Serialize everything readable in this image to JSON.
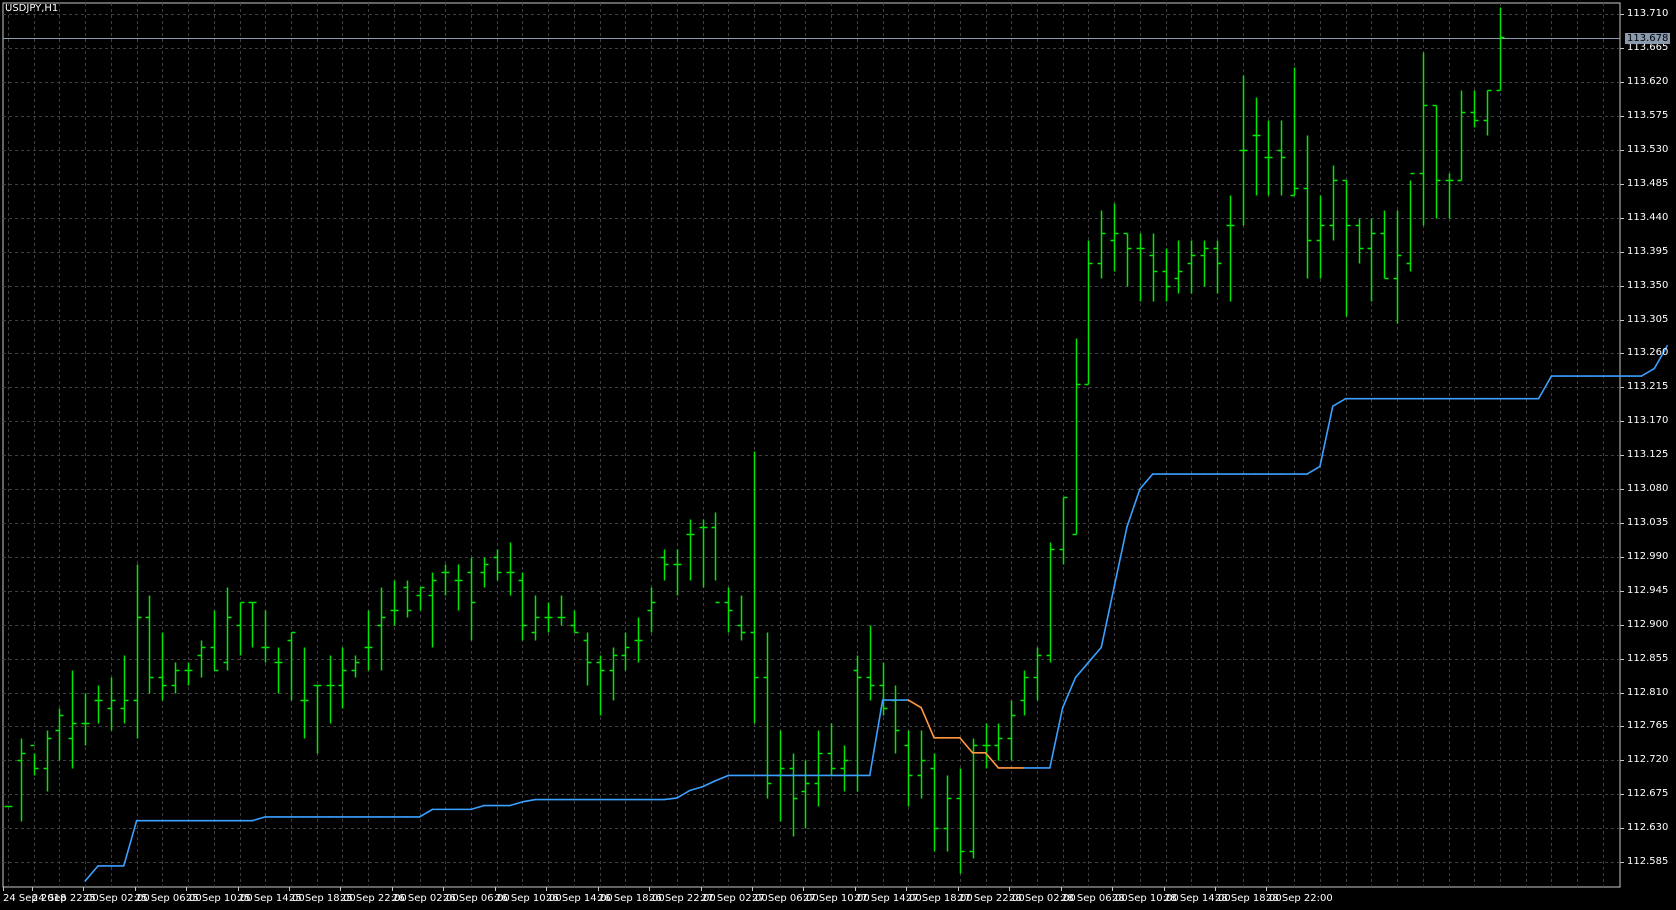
{
  "window_title": "USDJPY,H1",
  "colors": {
    "background": "#000000",
    "grid": "#404040",
    "bars": "#00e600",
    "ma_up": "#3ba0ff",
    "ma_down": "#ff9a40",
    "axis_text": "#ffffff",
    "price_line": "#8a9bb0"
  },
  "chart_data": {
    "type": "line",
    "title": "USDJPY,H1",
    "series_types": [
      "ohlc",
      "line"
    ],
    "ylim": [
      112.552,
      113.725
    ],
    "grid": true,
    "y_ticks": [
      "113.710",
      "113.665",
      "113.620",
      "113.575",
      "113.530",
      "113.485",
      "113.440",
      "113.395",
      "113.350",
      "113.305",
      "113.260",
      "113.215",
      "113.170",
      "113.125",
      "113.080",
      "113.035",
      "112.990",
      "112.945",
      "112.900",
      "112.855",
      "112.810",
      "112.765",
      "112.720",
      "112.675",
      "112.630",
      "112.585"
    ],
    "x_ticks": [
      "24 Sep 2018",
      "24 Sep 22:00",
      "25 Sep 02:00",
      "25 Sep 06:00",
      "25 Sep 10:00",
      "25 Sep 14:00",
      "25 Sep 18:00",
      "25 Sep 22:00",
      "26 Sep 02:00",
      "26 Sep 06:00",
      "26 Sep 10:00",
      "26 Sep 14:00",
      "26 Sep 18:00",
      "26 Sep 22:00",
      "27 Sep 02:00",
      "27 Sep 06:00",
      "27 Sep 10:00",
      "27 Sep 14:00",
      "27 Sep 18:00",
      "27 Sep 22:00",
      "28 Sep 02:00",
      "28 Sep 06:00",
      "28 Sep 10:00",
      "28 Sep 14:00",
      "28 Sep 18:00",
      "28 Sep 22:00"
    ],
    "current_price": "113.678",
    "ohlc": [
      [
        112.66,
        112.66,
        112.66,
        112.66
      ],
      [
        112.72,
        112.75,
        112.64,
        112.73
      ],
      [
        112.74,
        112.73,
        112.7,
        112.71
      ],
      [
        112.71,
        112.76,
        112.68,
        112.75
      ],
      [
        112.76,
        112.79,
        112.72,
        112.78
      ],
      [
        112.75,
        112.84,
        112.71,
        112.77
      ],
      [
        112.77,
        112.81,
        112.74,
        112.77
      ],
      [
        112.8,
        112.82,
        112.77,
        112.8
      ],
      [
        112.79,
        112.83,
        112.76,
        112.8
      ],
      [
        112.79,
        112.86,
        112.77,
        112.8
      ],
      [
        112.8,
        112.98,
        112.75,
        112.91
      ],
      [
        112.91,
        112.94,
        112.81,
        112.83
      ],
      [
        112.83,
        112.89,
        112.8,
        112.82
      ],
      [
        112.82,
        112.85,
        112.81,
        112.84
      ],
      [
        112.84,
        112.85,
        112.82,
        112.84
      ],
      [
        112.86,
        112.88,
        112.83,
        112.87
      ],
      [
        112.87,
        112.92,
        112.84,
        112.84
      ],
      [
        112.85,
        112.95,
        112.84,
        112.91
      ],
      [
        112.9,
        112.93,
        112.86,
        112.93
      ],
      [
        112.93,
        112.93,
        112.87,
        112.93
      ],
      [
        112.87,
        112.92,
        112.85,
        112.87
      ],
      [
        112.85,
        112.87,
        112.81,
        112.85
      ],
      [
        112.88,
        112.89,
        112.8,
        112.89
      ],
      [
        112.8,
        112.87,
        112.75,
        112.8
      ],
      [
        112.82,
        112.82,
        112.73,
        112.82
      ],
      [
        112.82,
        112.86,
        112.77,
        112.82
      ],
      [
        112.82,
        112.87,
        112.79,
        112.84
      ],
      [
        112.84,
        112.86,
        112.83,
        112.85
      ],
      [
        112.87,
        112.92,
        112.84,
        112.87
      ],
      [
        112.9,
        112.95,
        112.84,
        112.91
      ],
      [
        112.92,
        112.96,
        112.9,
        112.92
      ],
      [
        112.95,
        112.96,
        112.91,
        112.92
      ],
      [
        112.94,
        112.95,
        112.92,
        112.95
      ],
      [
        112.94,
        112.97,
        112.87,
        112.96
      ],
      [
        112.97,
        112.98,
        112.94,
        112.97
      ],
      [
        112.96,
        112.98,
        112.92,
        112.96
      ],
      [
        112.97,
        112.99,
        112.88,
        112.93
      ],
      [
        112.97,
        112.99,
        112.95,
        112.98
      ],
      [
        112.99,
        113.0,
        112.96,
        112.97
      ],
      [
        112.97,
        113.01,
        112.94,
        112.97
      ],
      [
        112.96,
        112.97,
        112.88,
        112.9
      ],
      [
        112.89,
        112.94,
        112.88,
        112.91
      ],
      [
        112.91,
        112.93,
        112.89,
        112.91
      ],
      [
        112.91,
        112.94,
        112.9,
        112.91
      ],
      [
        112.9,
        112.92,
        112.89,
        112.89
      ],
      [
        112.88,
        112.89,
        112.82,
        112.85
      ],
      [
        112.85,
        112.86,
        112.78,
        112.84
      ],
      [
        112.84,
        112.87,
        112.8,
        112.86
      ],
      [
        112.86,
        112.89,
        112.84,
        112.87
      ],
      [
        112.88,
        112.91,
        112.85,
        112.88
      ],
      [
        112.92,
        112.95,
        112.89,
        112.93
      ],
      [
        112.99,
        113.0,
        112.96,
        112.98
      ],
      [
        112.98,
        113.0,
        112.94,
        112.98
      ],
      [
        113.02,
        113.04,
        112.96,
        113.02
      ],
      [
        113.03,
        113.04,
        112.95,
        113.03
      ],
      [
        113.03,
        113.05,
        112.96,
        112.93
      ],
      [
        112.93,
        112.95,
        112.89,
        112.92
      ],
      [
        112.9,
        112.94,
        112.88,
        112.89
      ],
      [
        112.89,
        113.13,
        112.77,
        112.83
      ],
      [
        112.83,
        112.89,
        112.67,
        112.69
      ],
      [
        112.7,
        112.76,
        112.64,
        112.71
      ],
      [
        112.71,
        112.73,
        112.62,
        112.67
      ],
      [
        112.68,
        112.72,
        112.63,
        112.69
      ],
      [
        112.69,
        112.76,
        112.66,
        112.73
      ],
      [
        112.73,
        112.77,
        112.7,
        112.71
      ],
      [
        112.71,
        112.74,
        112.68,
        112.72
      ],
      [
        112.84,
        112.86,
        112.68,
        112.83
      ],
      [
        112.83,
        112.9,
        112.8,
        112.82
      ],
      [
        112.82,
        112.85,
        112.78,
        112.79
      ],
      [
        112.8,
        112.82,
        112.73,
        112.76
      ],
      [
        112.74,
        112.76,
        112.66,
        112.7
      ],
      [
        112.7,
        112.76,
        112.67,
        112.72
      ],
      [
        112.71,
        112.73,
        112.6,
        112.63
      ],
      [
        112.63,
        112.7,
        112.6,
        112.67
      ],
      [
        112.67,
        112.71,
        112.57,
        112.6
      ],
      [
        112.6,
        112.75,
        112.59,
        112.74
      ],
      [
        112.74,
        112.77,
        112.71,
        112.74
      ],
      [
        112.74,
        112.77,
        112.72,
        112.75
      ],
      [
        112.75,
        112.8,
        112.72,
        112.78
      ],
      [
        112.8,
        112.84,
        112.78,
        112.83
      ],
      [
        112.83,
        112.87,
        112.8,
        112.86
      ],
      [
        112.86,
        113.01,
        112.85,
        113.0
      ],
      [
        113.0,
        113.07,
        112.98,
        113.07
      ],
      [
        113.02,
        113.28,
        113.02,
        113.22
      ],
      [
        113.22,
        113.41,
        113.22,
        113.38
      ],
      [
        113.38,
        113.45,
        113.36,
        113.42
      ],
      [
        113.41,
        113.46,
        113.37,
        113.42
      ],
      [
        113.42,
        113.42,
        113.35,
        113.4
      ],
      [
        113.4,
        113.42,
        113.33,
        113.4
      ],
      [
        113.39,
        113.42,
        113.33,
        113.37
      ],
      [
        113.37,
        113.4,
        113.33,
        113.35
      ],
      [
        113.36,
        113.41,
        113.34,
        113.37
      ],
      [
        113.38,
        113.41,
        113.34,
        113.39
      ],
      [
        113.39,
        113.41,
        113.35,
        113.4
      ],
      [
        113.4,
        113.41,
        113.34,
        113.38
      ],
      [
        113.43,
        113.47,
        113.33,
        113.43
      ],
      [
        113.53,
        113.63,
        113.43,
        113.53
      ],
      [
        113.55,
        113.6,
        113.47,
        113.55
      ],
      [
        113.52,
        113.57,
        113.47,
        113.52
      ],
      [
        113.53,
        113.57,
        113.47,
        113.52
      ],
      [
        113.47,
        113.64,
        113.47,
        113.48
      ],
      [
        113.48,
        113.55,
        113.36,
        113.41
      ],
      [
        113.41,
        113.47,
        113.36,
        113.43
      ],
      [
        113.43,
        113.51,
        113.41,
        113.49
      ],
      [
        113.49,
        113.49,
        113.31,
        113.43
      ],
      [
        113.43,
        113.44,
        113.38,
        113.4
      ],
      [
        113.4,
        113.44,
        113.33,
        113.42
      ],
      [
        113.42,
        113.45,
        113.36,
        113.36
      ],
      [
        113.36,
        113.45,
        113.3,
        113.39
      ],
      [
        113.38,
        113.49,
        113.37,
        113.5
      ],
      [
        113.5,
        113.66,
        113.43,
        113.59
      ],
      [
        113.59,
        113.59,
        113.44,
        113.49
      ],
      [
        113.49,
        113.5,
        113.44,
        113.49
      ],
      [
        113.49,
        113.61,
        113.49,
        113.58
      ],
      [
        113.58,
        113.61,
        113.56,
        113.57
      ],
      [
        113.57,
        113.61,
        113.55,
        113.61
      ],
      [
        113.61,
        113.72,
        113.61,
        113.68
      ]
    ],
    "moving_average": [
      null,
      null,
      null,
      null,
      null,
      null,
      112.56,
      112.58,
      112.58,
      112.58,
      112.64,
      112.64,
      112.64,
      112.64,
      112.64,
      112.64,
      112.64,
      112.64,
      112.64,
      112.64,
      112.645,
      112.645,
      112.645,
      112.645,
      112.645,
      112.645,
      112.645,
      112.645,
      112.645,
      112.645,
      112.645,
      112.645,
      112.645,
      112.655,
      112.655,
      112.655,
      112.655,
      112.66,
      112.66,
      112.66,
      112.665,
      112.668,
      112.668,
      112.668,
      112.668,
      112.668,
      112.668,
      112.668,
      112.668,
      112.668,
      112.668,
      112.668,
      112.67,
      112.68,
      112.685,
      112.693,
      112.7,
      112.7,
      112.7,
      112.7,
      112.7,
      112.7,
      112.7,
      112.7,
      112.7,
      112.7,
      112.7,
      112.7,
      112.8,
      112.8,
      112.8,
      112.79,
      112.75,
      112.75,
      112.75,
      112.73,
      112.73,
      112.71,
      112.71,
      112.71,
      112.71,
      112.71,
      112.79,
      112.83,
      112.85,
      112.87,
      112.95,
      113.03,
      113.08,
      113.1,
      113.1,
      113.1,
      113.1,
      113.1,
      113.1,
      113.1,
      113.1,
      113.1,
      113.1,
      113.1,
      113.1,
      113.1,
      113.11,
      113.19,
      113.2,
      113.2,
      113.2,
      113.2,
      113.2,
      113.2,
      113.2,
      113.2,
      113.2,
      113.2,
      113.2,
      113.2,
      113.2,
      113.2,
      113.2,
      113.2,
      113.23,
      113.23,
      113.23,
      113.23,
      113.23,
      113.23,
      113.23,
      113.23,
      113.24,
      113.27
    ],
    "ma_down_segments": [
      [
        70,
        79
      ]
    ]
  }
}
